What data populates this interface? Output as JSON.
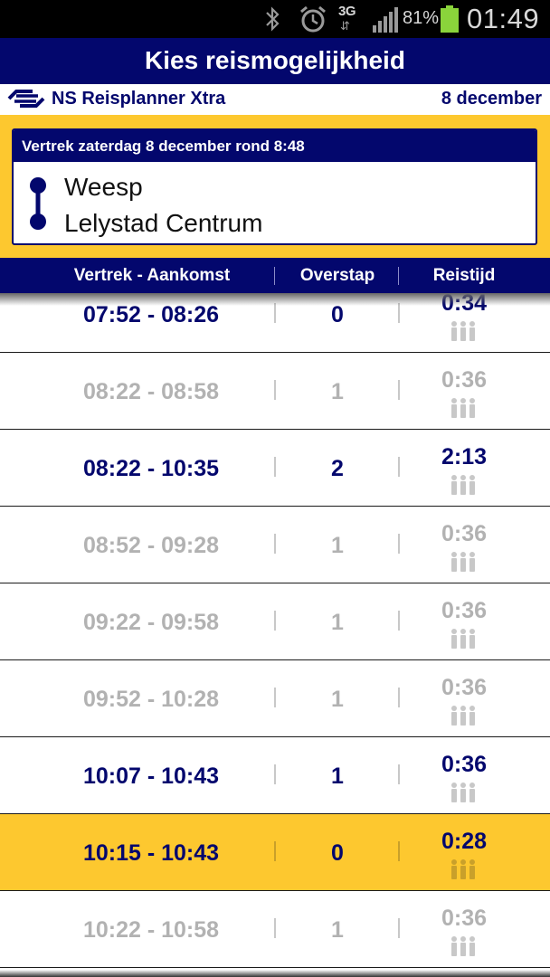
{
  "status_bar": {
    "battery_percent": "81%",
    "network": "3G",
    "time": "01:49",
    "icons": [
      "bluetooth-icon",
      "alarm-icon",
      "network-3g-icon",
      "signal-icon",
      "battery-icon"
    ],
    "battery_color": "#8ad43b"
  },
  "title_bar": {
    "title": "Kies reismogelijkheid"
  },
  "sub_header": {
    "app_name": "NS Reisplanner Xtra",
    "date": "8 december"
  },
  "route": {
    "departure_line": "Vertrek zaterdag 8 december rond 8:48",
    "from": "Weesp",
    "to": "Lelystad Centrum"
  },
  "columns": {
    "time": "Vertrek - Aankomst",
    "transfers": "Overstap",
    "duration": "Reistijd"
  },
  "rows": [
    {
      "time": "07:52 - 08:26",
      "transfers": "0",
      "duration": "0:34",
      "state": "ok"
    },
    {
      "time": "08:22 - 08:58",
      "transfers": "1",
      "duration": "0:36",
      "state": "dim"
    },
    {
      "time": "08:22 - 10:35",
      "transfers": "2",
      "duration": "2:13",
      "state": "ok"
    },
    {
      "time": "08:52 - 09:28",
      "transfers": "1",
      "duration": "0:36",
      "state": "dim"
    },
    {
      "time": "09:22 - 09:58",
      "transfers": "1",
      "duration": "0:36",
      "state": "dim"
    },
    {
      "time": "09:52 - 10:28",
      "transfers": "1",
      "duration": "0:36",
      "state": "dim"
    },
    {
      "time": "10:07 - 10:43",
      "transfers": "1",
      "duration": "0:36",
      "state": "ok"
    },
    {
      "time": "10:15 - 10:43",
      "transfers": "0",
      "duration": "0:28",
      "state": "selected"
    },
    {
      "time": "10:22 - 10:58",
      "transfers": "1",
      "duration": "0:36",
      "state": "dim"
    }
  ],
  "colors": {
    "ns_blue": "#03076d",
    "ns_yellow": "#fdc82f",
    "dim_text": "#b2b2b2"
  }
}
